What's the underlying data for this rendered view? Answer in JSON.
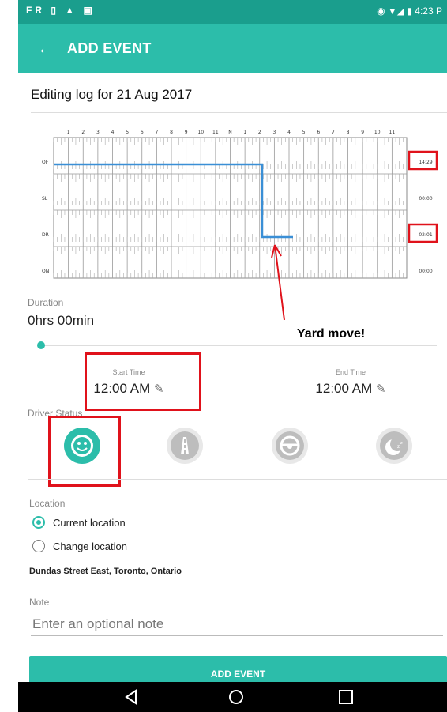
{
  "status_bar": {
    "left_icons": "FR ▯ ▲ ▣",
    "time": "4:23 P"
  },
  "app_bar": {
    "back_icon": "arrow-left-icon",
    "title": "ADD EVENT"
  },
  "editing_label": "Editing log for 21 Aug 2017",
  "log_graph": {
    "hour_labels": [
      "1",
      "2",
      "3",
      "4",
      "5",
      "6",
      "7",
      "8",
      "9",
      "10",
      "11",
      "N",
      "1",
      "2",
      "3",
      "4",
      "5",
      "6",
      "7",
      "8",
      "9",
      "10",
      "11"
    ],
    "rows": [
      {
        "label": "OF",
        "total": "14:29",
        "highlighted": true
      },
      {
        "label": "SL",
        "total": "00:00",
        "highlighted": false
      },
      {
        "label": "DR",
        "total": "02:01",
        "highlighted": true
      },
      {
        "label": "ON",
        "total": "00:00",
        "highlighted": false
      }
    ],
    "line_color": "#3a8fd6"
  },
  "annotation": {
    "text": "Yard move!"
  },
  "duration": {
    "label": "Duration",
    "value": "0hrs 00min"
  },
  "start_time": {
    "label": "Start Time",
    "value": "12:00 AM"
  },
  "end_time": {
    "label": "End Time",
    "value": "12:00 AM"
  },
  "driver_status": {
    "label": "Driver Status",
    "options": [
      {
        "icon": "smiley-face-icon",
        "selected": true
      },
      {
        "icon": "road-icon",
        "selected": false
      },
      {
        "icon": "steering-wheel-icon",
        "selected": false
      },
      {
        "icon": "moon-sleep-icon",
        "selected": false
      }
    ]
  },
  "location": {
    "label": "Location",
    "options": [
      {
        "label": "Current location",
        "selected": true
      },
      {
        "label": "Change location",
        "selected": false
      }
    ],
    "address": "Dundas Street East, Toronto, Ontario"
  },
  "note": {
    "label": "Note",
    "placeholder": "Enter an optional note"
  },
  "add_button": {
    "label": "ADD EVENT"
  },
  "nav_bar": {
    "icons": [
      "back-triangle-icon",
      "home-circle-icon",
      "recents-square-icon"
    ]
  },
  "colors": {
    "accent": "#2cbdaa",
    "status_bar": "#1a9e8d",
    "highlight": "#e0121b"
  }
}
